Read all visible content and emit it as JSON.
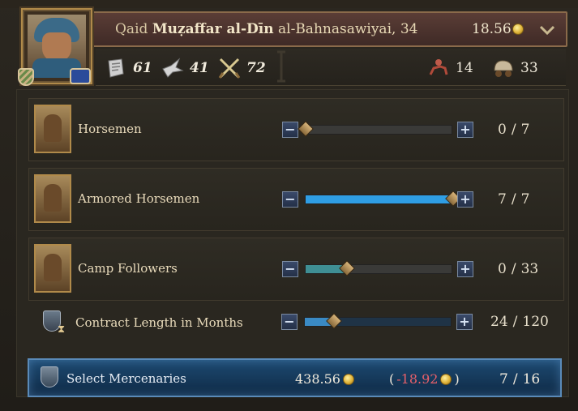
{
  "character": {
    "title": "Qaid",
    "name": "Muẓaffar al-Dīn",
    "dynasty": "al-Bahnasawiyai",
    "age_suffix": ", 34",
    "gold": "18.56"
  },
  "stats": {
    "martial": "61",
    "diplomacy": "41",
    "prowess": "72",
    "levies": "14",
    "supply": "33"
  },
  "units": [
    {
      "name": "Horsemen",
      "current": "0",
      "max": "7",
      "fill_fraction": 0,
      "bar_color": "#5fb4c4"
    },
    {
      "name": "Armored Horsemen",
      "current": "7",
      "max": "7",
      "fill_fraction": 1.0,
      "bar_color": "#2f9ee4"
    },
    {
      "name": "Camp Followers",
      "current": "0",
      "max": "33",
      "fill_fraction": 0.28,
      "bar_color": "#3f8f94"
    }
  ],
  "contract": {
    "label": "Contract Length in Months",
    "current": "24",
    "max": "120",
    "fill_fraction": 0.2
  },
  "select": {
    "label": "Select Mercenaries",
    "cost": "438.56",
    "upkeep_open": "(",
    "upkeep_value": "-18.92",
    "upkeep_close": ")",
    "selected": "7",
    "max": "16"
  },
  "ui": {
    "slash": "/",
    "minus": "−",
    "plus": "+"
  },
  "colors": {
    "accent_gold": "#e0b43a",
    "negative": "#e8606a",
    "select_bar": "#1d4a72"
  }
}
